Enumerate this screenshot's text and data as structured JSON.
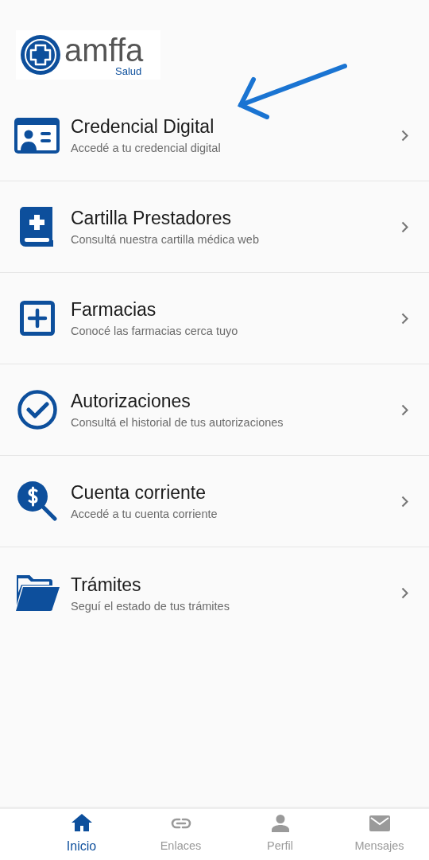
{
  "logo": {
    "name": "amffa",
    "tagline": "Salud"
  },
  "menu": [
    {
      "kind": "card",
      "title": "Credencial Digital",
      "subtitle": "Accedé a tu credencial digital"
    },
    {
      "kind": "book",
      "title": "Cartilla Prestadores",
      "subtitle": "Consultá nuestra cartilla médica web"
    },
    {
      "kind": "plus",
      "title": "Farmacias",
      "subtitle": "Conocé las farmacias cerca tuyo"
    },
    {
      "kind": "check",
      "title": "Autorizaciones",
      "subtitle": "Consultá el historial de tus autorizaciones"
    },
    {
      "kind": "money",
      "title": "Cuenta corriente",
      "subtitle": "Accedé a tu cuenta corriente"
    },
    {
      "kind": "folder",
      "title": "Trámites",
      "subtitle": "Seguí el estado de tus trámites"
    }
  ],
  "nav": [
    {
      "kind": "home",
      "label": "Inicio",
      "selected": true
    },
    {
      "kind": "link",
      "label": "Enlaces",
      "selected": false
    },
    {
      "kind": "person",
      "label": "Perfil",
      "selected": false
    },
    {
      "kind": "mail",
      "label": "Mensajes",
      "selected": false
    }
  ]
}
